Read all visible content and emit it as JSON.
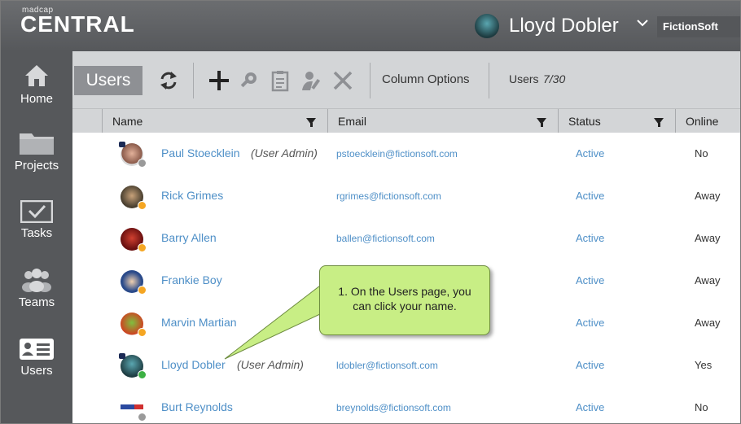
{
  "header": {
    "logo_small": "madcap",
    "logo_big": "CENTRAL",
    "user_name": "Lloyd Dobler",
    "org": "FictionSoft"
  },
  "sidebar": {
    "items": [
      {
        "label": "Home",
        "icon": "home-icon"
      },
      {
        "label": "Projects",
        "icon": "folder-icon"
      },
      {
        "label": "Tasks",
        "icon": "tasks-icon"
      },
      {
        "label": "Teams",
        "icon": "teams-icon"
      },
      {
        "label": "Users",
        "icon": "users-card-icon"
      }
    ]
  },
  "toolbar": {
    "title": "Users",
    "column_options": "Column Options",
    "users_label": "Users",
    "users_count": "7/30",
    "icons": [
      "refresh-icon",
      "add-icon",
      "settings-icon",
      "clipboard-icon",
      "user-edit-icon",
      "delete-icon"
    ]
  },
  "table": {
    "columns": {
      "name": "Name",
      "email": "Email",
      "status": "Status",
      "online": "Online"
    },
    "rows": [
      {
        "name": "Paul Stoecklein",
        "role": "(User Admin)",
        "email": "pstoecklein@fictionsoft.com",
        "status": "Active",
        "online": "No",
        "dot": "#9a9a9a"
      },
      {
        "name": "Rick Grimes",
        "role": "",
        "email": "rgrimes@fictionsoft.com",
        "status": "Active",
        "online": "Away",
        "dot": "#f5a623"
      },
      {
        "name": "Barry Allen",
        "role": "",
        "email": "ballen@fictionsoft.com",
        "status": "Active",
        "online": "Away",
        "dot": "#f5a623"
      },
      {
        "name": "Frankie Boy",
        "role": "",
        "email": "",
        "status": "Active",
        "online": "Away",
        "dot": "#f5a623"
      },
      {
        "name": "Marvin Martian",
        "role": "",
        "email": "",
        "status": "Active",
        "online": "Away",
        "dot": "#f5a623"
      },
      {
        "name": "Lloyd Dobler",
        "role": "(User Admin)",
        "email": "ldobler@fictionsoft.com",
        "status": "Active",
        "online": "Yes",
        "dot": "#3cb043"
      },
      {
        "name": "Burt Reynolds",
        "role": "",
        "email": "breynolds@fictionsoft.com",
        "status": "Active",
        "online": "No",
        "dot": "#9a9a9a"
      }
    ]
  },
  "callout": {
    "line1": "1. On the Users page, you",
    "line2": "can click your name."
  },
  "colors": {
    "accent": "#4e8fc7",
    "callout": "#c8ee85",
    "sidebar": "#56585b"
  }
}
